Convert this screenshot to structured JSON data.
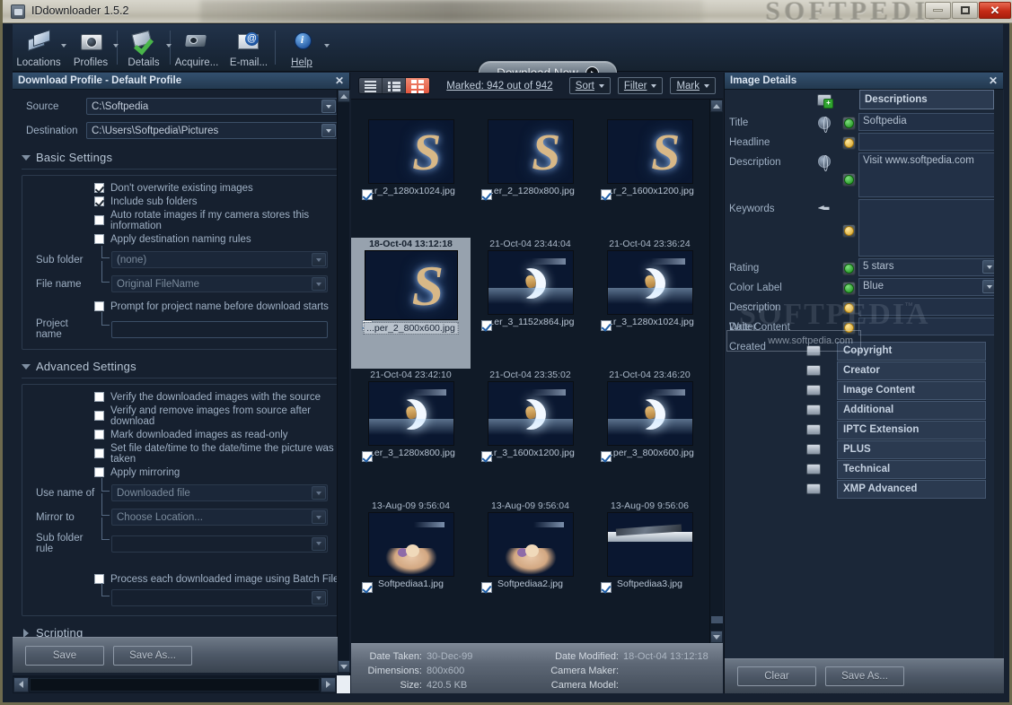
{
  "window": {
    "title": "IDdownloader 1.5.2",
    "watermark": "SOFTPEDIA",
    "minimize": "—",
    "maximize": "□",
    "close": "✕"
  },
  "ribbon": {
    "items": [
      {
        "label": "Locations",
        "icon": "locations-icon",
        "arrow": true
      },
      {
        "label": "Profiles",
        "icon": "camera-icon",
        "arrow": true
      },
      {
        "label": "Details",
        "icon": "details-check-icon",
        "arrow": true
      },
      {
        "label": "Acquire...",
        "icon": "scanner-icon",
        "arrow": false
      },
      {
        "label": "E-mail...",
        "icon": "email-icon",
        "arrow": false
      },
      {
        "label": "Help",
        "icon": "info-icon",
        "arrow": true
      }
    ],
    "download_now": "Download Now"
  },
  "left_panel": {
    "title": "Download Profile - Default Profile",
    "close": "✕",
    "source_label": "Source",
    "source_value": "C:\\Softpedia",
    "destination_label": "Destination",
    "destination_value": "C:\\Users\\Softpedia\\Pictures",
    "basic_settings": {
      "heading": "Basic Settings",
      "checkboxes": [
        {
          "label": "Don't overwrite existing images",
          "checked": true
        },
        {
          "label": "Include sub folders",
          "checked": true
        },
        {
          "label": "Auto rotate images if my camera stores this information",
          "checked": false
        },
        {
          "label": "Apply destination naming rules",
          "checked": false
        }
      ],
      "sub_folder_label": "Sub folder",
      "sub_folder_value": "(none)",
      "file_name_label": "File name",
      "file_name_value": "Original FileName",
      "prompt_checkbox": {
        "label": "Prompt for project name before download starts",
        "checked": false
      },
      "project_name_label": "Project name",
      "project_name_value": ""
    },
    "advanced_settings": {
      "heading": "Advanced Settings",
      "checkboxes": [
        {
          "label": "Verify the downloaded images with the source",
          "checked": false
        },
        {
          "label": "Verify and remove images from source after download",
          "checked": false
        },
        {
          "label": "Mark downloaded images as read-only",
          "checked": false
        },
        {
          "label": "Set file date/time to the date/time the picture was taken",
          "checked": false
        },
        {
          "label": "Apply mirroring",
          "checked": false
        }
      ],
      "use_name_of_label": "Use name of",
      "use_name_of_value": "Downloaded file",
      "mirror_to_label": "Mirror to",
      "mirror_to_value": "Choose Location...",
      "sub_folder_rule_label": "Sub folder rule",
      "sub_folder_rule_value": "",
      "batch_checkbox": {
        "label": "Process each downloaded image using Batch File",
        "checked": false
      },
      "batch_value": ""
    },
    "scripting_heading": "Scripting",
    "save_button": "Save",
    "save_as_button": "Save As..."
  },
  "center_panel": {
    "view_modes": [
      "list-view-icon",
      "detail-view-icon",
      "grid-view-icon"
    ],
    "active_view": 2,
    "marked_text": "Marked: 942 out of 942",
    "sort_button": "Sort",
    "filter_button": "Filter",
    "mark_button": "Mark",
    "thumbnails": [
      {
        "date": "",
        "name": "...r_2_1280x1024.jpg",
        "checked": true,
        "art": "art-s",
        "selected": false
      },
      {
        "date": "",
        "name": "...er_2_1280x800.jpg",
        "checked": true,
        "art": "art-s",
        "selected": false
      },
      {
        "date": "",
        "name": "...r_2_1600x1200.jpg",
        "checked": true,
        "art": "art-s",
        "selected": false
      },
      {
        "date": "18-Oct-04 13:12:18",
        "name": "...per_2_800x600.jpg",
        "checked": true,
        "art": "art-s",
        "selected": true
      },
      {
        "date": "21-Oct-04 23:44:04",
        "name": "...er_3_1152x864.jpg",
        "checked": true,
        "art": "art-moon",
        "selected": false
      },
      {
        "date": "21-Oct-04 23:36:24",
        "name": "...r_3_1280x1024.jpg",
        "checked": true,
        "art": "art-moon",
        "selected": false
      },
      {
        "date": "21-Oct-04 23:42:10",
        "name": "...er_3_1280x800.jpg",
        "checked": true,
        "art": "art-moon",
        "selected": false
      },
      {
        "date": "21-Oct-04 23:35:02",
        "name": "...r_3_1600x1200.jpg",
        "checked": true,
        "art": "art-moon",
        "selected": false
      },
      {
        "date": "21-Oct-04 23:46:20",
        "name": "...per_3_800x600.jpg",
        "checked": true,
        "art": "art-moon",
        "selected": false
      },
      {
        "date": "13-Aug-09 9:56:04",
        "name": "Softpediaa1.jpg",
        "checked": true,
        "art": "art-girl",
        "selected": false
      },
      {
        "date": "13-Aug-09 9:56:04",
        "name": "Softpediaa2.jpg",
        "checked": true,
        "art": "art-girl",
        "selected": false
      },
      {
        "date": "13-Aug-09 9:56:06",
        "name": "Softpediaa3.jpg",
        "checked": true,
        "art": "art-beach",
        "selected": false
      }
    ],
    "info_bar": {
      "left": [
        {
          "key": "Date Taken:",
          "value": "30-Dec-99"
        },
        {
          "key": "Dimensions:",
          "value": "800x600"
        },
        {
          "key": "Size:",
          "value": "420.5 KB"
        }
      ],
      "right": [
        {
          "key": "Date Modified:",
          "value": "18-Oct-04 13:12:18"
        },
        {
          "key": "Camera Maker:",
          "value": ""
        },
        {
          "key": "Camera Model:",
          "value": ""
        }
      ]
    }
  },
  "right_panel": {
    "title": "Image Details",
    "close": "✕",
    "descriptions_header": "Descriptions",
    "fields": [
      {
        "label": "Title",
        "value": "Softpedia",
        "status": "green",
        "globe": true,
        "type": "text"
      },
      {
        "label": "Headline",
        "value": "",
        "status": "yellow",
        "globe": false,
        "type": "text"
      },
      {
        "label": "Description",
        "value": "Visit www.softpedia.com",
        "status": "green",
        "globe": true,
        "type": "textarea"
      },
      {
        "label": "Keywords",
        "value": "",
        "status": "yellow",
        "globe": false,
        "type": "textarea-big"
      },
      {
        "label": "Rating",
        "value": "5 stars",
        "status": "green",
        "globe": false,
        "type": "dropdown"
      },
      {
        "label": "Color Label",
        "value": "Blue",
        "status": "green",
        "globe": false,
        "type": "dropdown"
      },
      {
        "label": "Description Writer",
        "value": "",
        "status": "yellow",
        "globe": false,
        "type": "text"
      },
      {
        "label": "Date Content Created",
        "value": "",
        "status": "yellow",
        "globe": false,
        "type": "text"
      }
    ],
    "categories": [
      "Copyright",
      "Creator",
      "Image Content",
      "Additional",
      "IPTC Extension",
      "PLUS",
      "Technical",
      "XMP Advanced"
    ],
    "clear_button": "Clear",
    "save_as_button": "Save As..."
  },
  "overlay": {
    "watermark_big": "SOFTPEDIA",
    "watermark_url": "www.softpedia.com",
    "tm": "™"
  }
}
